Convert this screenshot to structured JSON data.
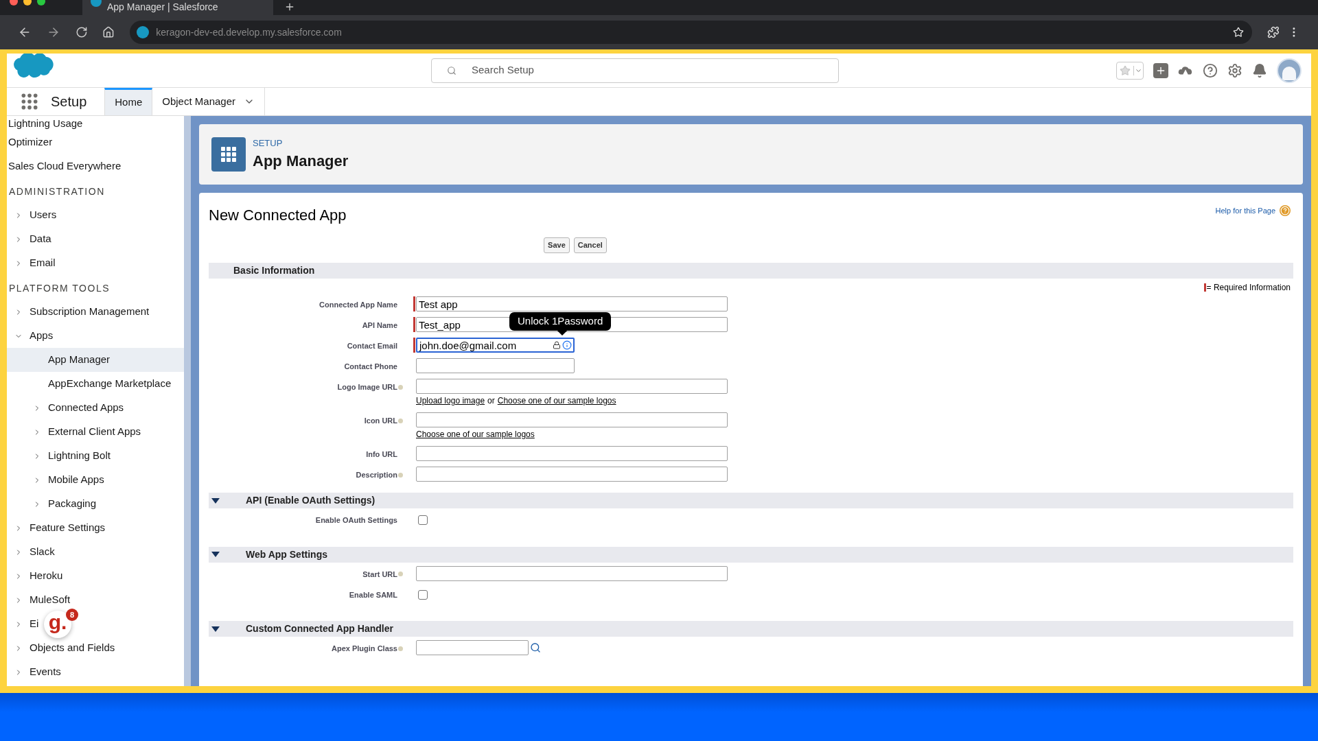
{
  "browser": {
    "tab_title": "App Manager | Salesforce",
    "url": "keragon-dev-ed.develop.my.salesforce.com"
  },
  "header": {
    "search_placeholder": "Search Setup"
  },
  "nav": {
    "app_name": "Setup",
    "tabs": [
      {
        "label": "Home",
        "selected": true,
        "kind": "plain"
      },
      {
        "label": "Object Manager",
        "selected": false,
        "kind": "menu"
      }
    ]
  },
  "sidebar": {
    "items": [
      {
        "kind": "link",
        "label": "Lightning Usage",
        "selected": false
      },
      {
        "kind": "link",
        "label": "Optimizer",
        "selected": false
      },
      {
        "kind": "link",
        "label": "Sales Cloud Everywhere",
        "selected": false
      },
      {
        "kind": "heading",
        "label": "ADMINISTRATION"
      },
      {
        "kind": "group",
        "label": "Users",
        "expanded": false,
        "selected": false
      },
      {
        "kind": "group",
        "label": "Data",
        "expanded": false,
        "selected": false
      },
      {
        "kind": "group",
        "label": "Email",
        "expanded": false,
        "selected": false
      },
      {
        "kind": "heading",
        "label": "PLATFORM TOOLS"
      },
      {
        "kind": "group",
        "label": "Subscription Management",
        "expanded": false,
        "selected": false
      },
      {
        "kind": "group",
        "label": "Apps",
        "expanded": true,
        "selected": false,
        "children": [
          {
            "kind": "link",
            "label": "App Manager",
            "selected": true
          },
          {
            "kind": "link",
            "label": "AppExchange Marketplace",
            "selected": false
          },
          {
            "kind": "group",
            "label": "Connected Apps",
            "expanded": false,
            "selected": false
          },
          {
            "kind": "group",
            "label": "External Client Apps",
            "expanded": false,
            "selected": false
          },
          {
            "kind": "group",
            "label": "Lightning Bolt",
            "expanded": false,
            "selected": false
          },
          {
            "kind": "group",
            "label": "Mobile Apps",
            "expanded": false,
            "selected": false
          },
          {
            "kind": "group",
            "label": "Packaging",
            "expanded": false,
            "selected": false
          }
        ]
      },
      {
        "kind": "group",
        "label": "Feature Settings",
        "expanded": false,
        "selected": false
      },
      {
        "kind": "group",
        "label": "Slack",
        "expanded": false,
        "selected": false
      },
      {
        "kind": "group",
        "label": "Heroku",
        "expanded": false,
        "selected": false
      },
      {
        "kind": "group",
        "label": "MuleSoft",
        "expanded": false,
        "selected": false
      },
      {
        "kind": "group",
        "label": "Ei",
        "expanded": false,
        "selected": false
      },
      {
        "kind": "group",
        "label": "Objects and Fields",
        "expanded": false,
        "selected": false
      },
      {
        "kind": "group",
        "label": "Events",
        "expanded": false,
        "selected": false
      }
    ]
  },
  "page_header": {
    "eyebrow": "SETUP",
    "title": "App Manager"
  },
  "form": {
    "title": "New Connected App",
    "help_link": "Help for this Page",
    "buttons": [
      "Save",
      "Cancel"
    ],
    "required_legend": "= Required Information",
    "sections": [
      {
        "title": "Basic Information",
        "fields": [
          {
            "label": "Connected App Name",
            "kind": "text",
            "value": "Test app",
            "required": true,
            "help": false
          },
          {
            "label": "API Name",
            "kind": "text",
            "value": "Test_app",
            "required": true,
            "help": false
          },
          {
            "label": "Contact Email",
            "kind": "email",
            "value": "john.doe@gmail.com",
            "required": true,
            "help": false,
            "focused": true,
            "tooltip": "Unlock 1Password"
          },
          {
            "label": "Contact Phone",
            "kind": "phone",
            "required": false,
            "help": false
          },
          {
            "label": "Logo Image URL",
            "kind": "text",
            "required": false,
            "help": true,
            "links": [
              "Upload logo image",
              "Choose one of our sample logos"
            ],
            "link_separator": "or"
          },
          {
            "label": "Icon URL",
            "kind": "text",
            "required": false,
            "help": true,
            "links": [
              "Choose one of our sample logos"
            ]
          },
          {
            "label": "Info URL",
            "kind": "text",
            "required": false,
            "help": false
          },
          {
            "label": "Description",
            "kind": "text",
            "required": false,
            "help": true
          }
        ]
      },
      {
        "title": "API (Enable OAuth Settings)",
        "expanded": true,
        "fields": [
          {
            "label": "Enable OAuth Settings",
            "kind": "checkbox",
            "checked": false,
            "help": false
          }
        ]
      },
      {
        "title": "Web App Settings",
        "expanded": true,
        "fields": [
          {
            "label": "Start URL",
            "kind": "text",
            "required": false,
            "help": true
          },
          {
            "label": "Enable SAML",
            "kind": "checkbox",
            "checked": false,
            "help": false
          }
        ]
      },
      {
        "title": "Custom Connected App Handler",
        "expanded": true,
        "fields": [
          {
            "label": "Apex Plugin Class",
            "kind": "lookup",
            "required": false,
            "help": true
          }
        ]
      }
    ]
  },
  "floating_badge": {
    "logo": "g.",
    "count": "8"
  }
}
